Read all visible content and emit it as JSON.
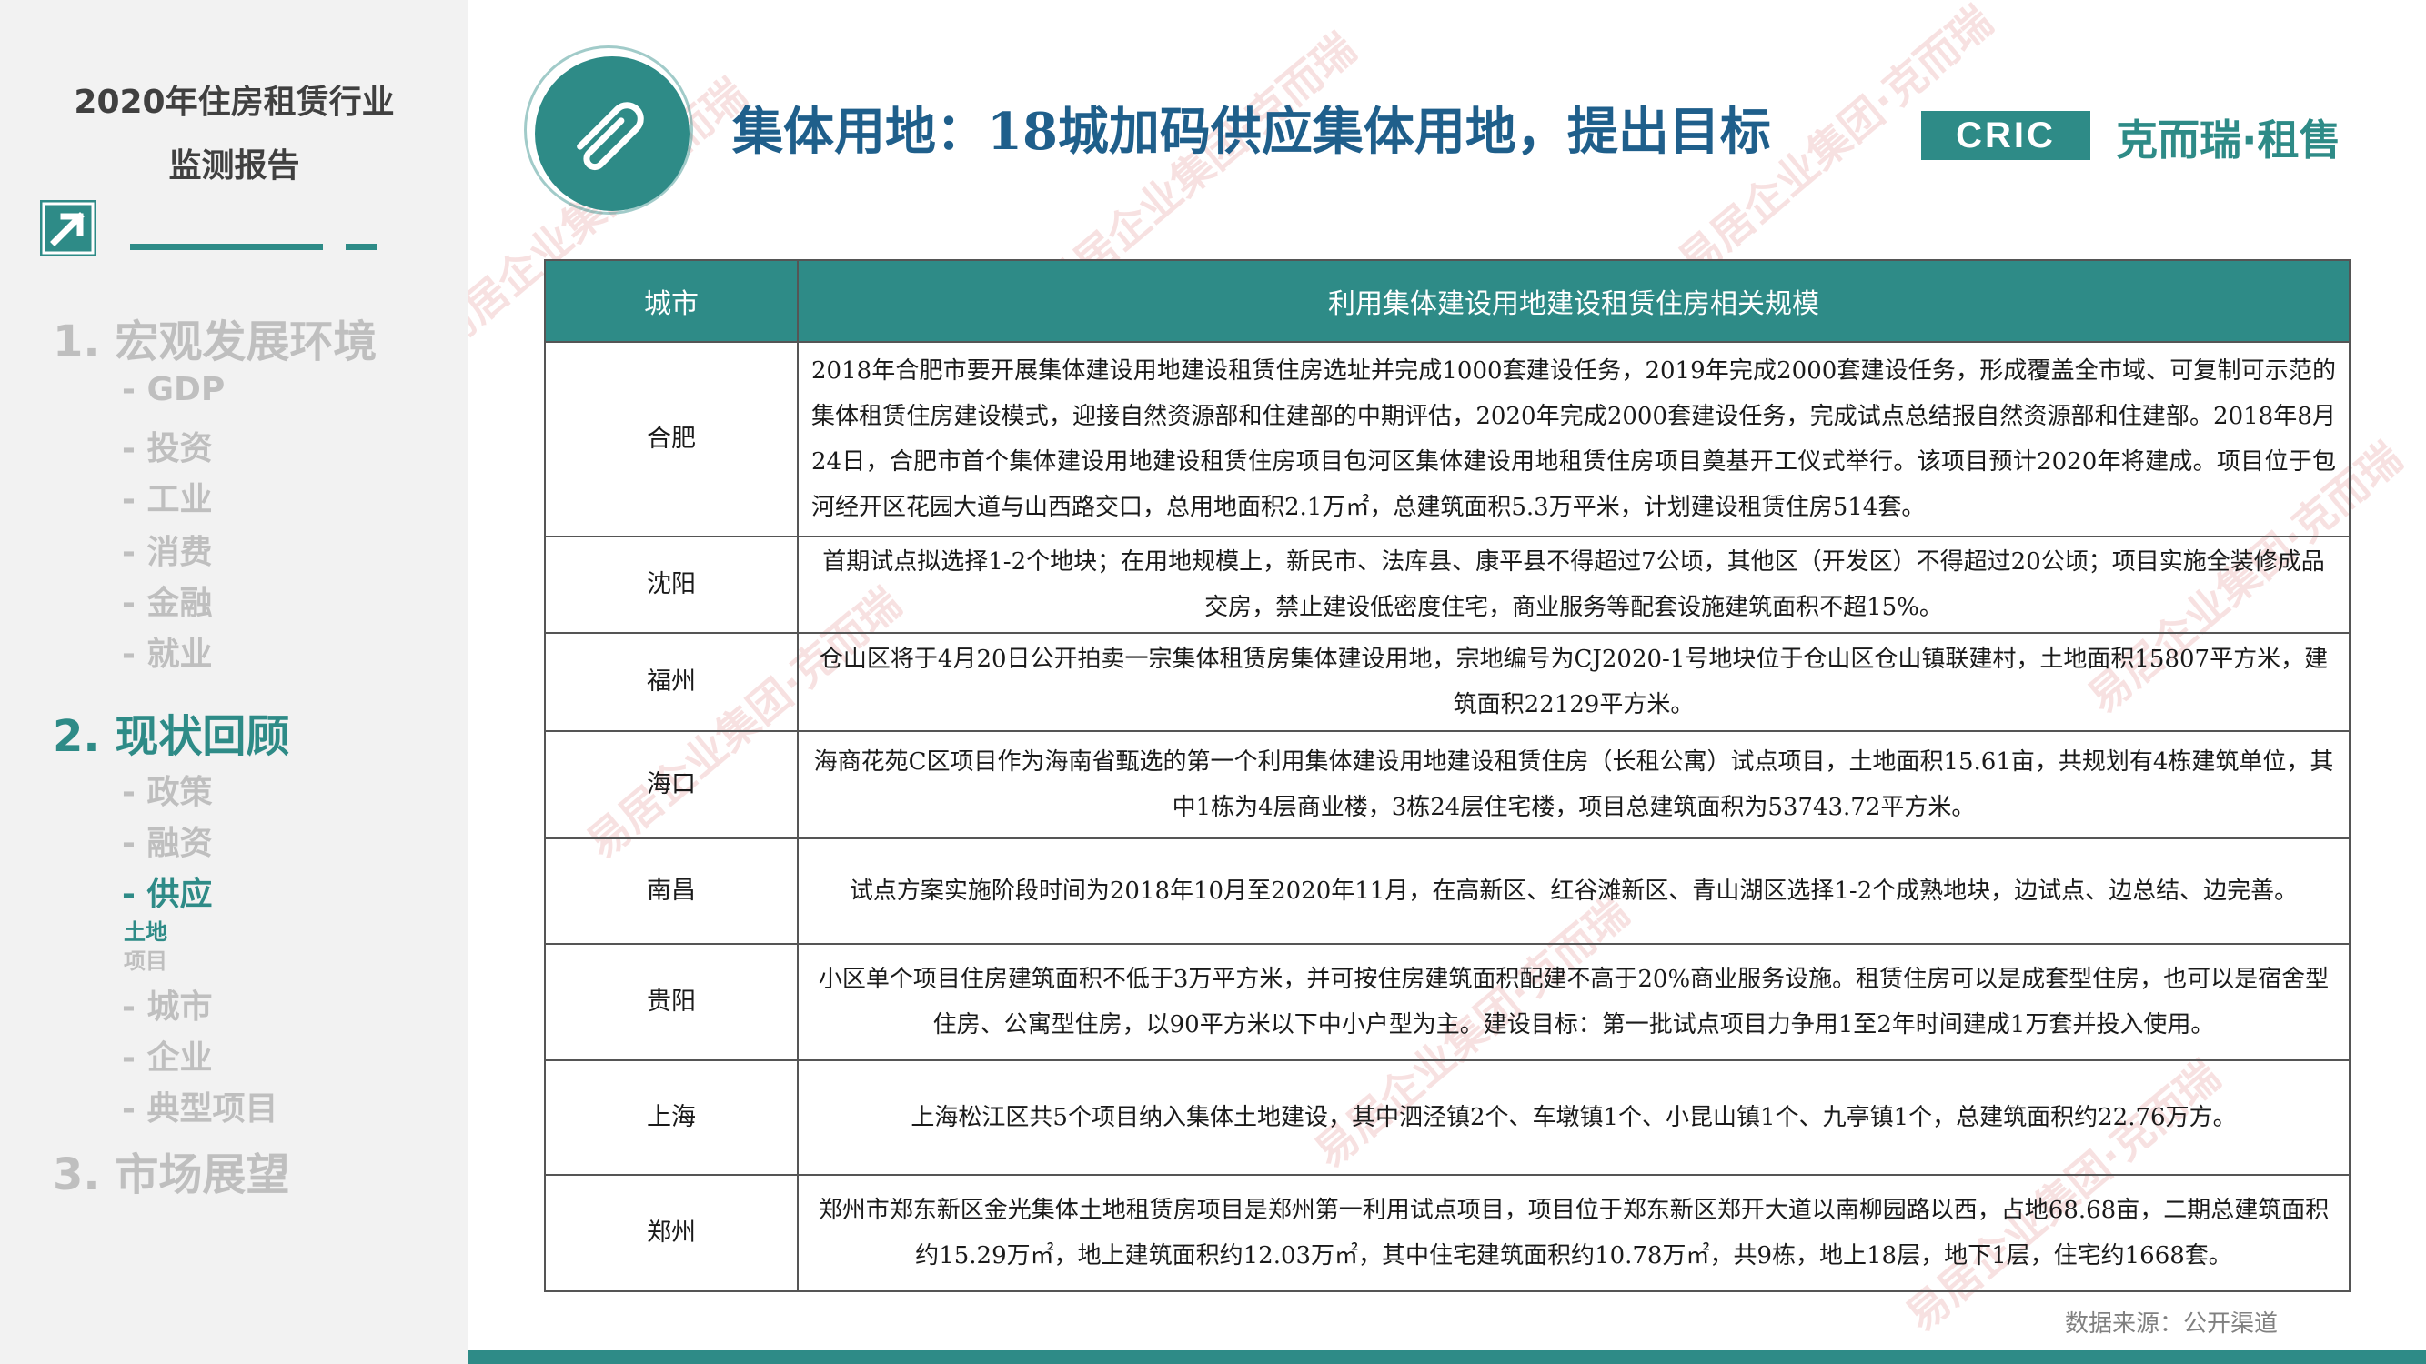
{
  "sidebar": {
    "title_line1": "2020年住房租赁行业",
    "title_line2": "监测报告",
    "sections": [
      {
        "label": "1. 宏观发展环境",
        "subs": [
          "- GDP",
          "- 投资",
          "- 工业",
          "- 消费",
          "- 金融",
          "- 就业"
        ]
      },
      {
        "label": "2. 现状回顾",
        "subs": [
          "- 政策",
          "- 融资",
          "- 供应",
          "- 城市",
          "- 企业",
          "- 典型项目"
        ],
        "supply_subs": [
          "土地",
          "项目"
        ]
      },
      {
        "label": "3. 市场展望"
      }
    ]
  },
  "header": {
    "title": "集体用地：18城加码供应集体用地，提出目标",
    "cric_logo": "CRIC",
    "brand_logo": "克而瑞·租售"
  },
  "table": {
    "headers": [
      "城市",
      "利用集体建设用地建设租赁住房相关规模"
    ],
    "rows": [
      {
        "city": "合肥",
        "text": "2018年合肥市要开展集体建设用地建设租赁住房选址并完成1000套建设任务，2019年完成2000套建设任务，形成覆盖全市域、可复制可示范的集体租赁住房建设模式，迎接自然资源部和住建部的中期评估，2020年完成2000套建设任务，完成试点总结报自然资源部和住建部。2018年8月24日，合肥市首个集体建设用地建设租赁住房项目包河区集体建设用地租赁住房项目奠基开工仪式举行。该项目预计2020年将建成。项目位于包河经开区花园大道与山西路交口，总用地面积2.1万㎡，总建筑面积5.3万平米，计划建设租赁住房514套。"
      },
      {
        "city": "沈阳",
        "text": "首期试点拟选择1-2个地块；在用地规模上，新民市、法库县、康平县不得超过7公顷，其他区（开发区）不得超过20公顷；项目实施全装修成品交房，禁止建设低密度住宅，商业服务等配套设施建筑面积不超15%。"
      },
      {
        "city": "福州",
        "text": "仓山区将于4月20日公开拍卖一宗集体租赁房集体建设用地，宗地编号为CJ2020-1号地块位于仓山区仓山镇联建村，土地面积15807平方米，建筑面积22129平方米。"
      },
      {
        "city": "海口",
        "text": "海商花苑C区项目作为海南省甄选的第一个利用集体建设用地建设租赁住房（长租公寓）试点项目，土地面积15.61亩，共规划有4栋建筑单位，其中1栋为4层商业楼，3栋24层住宅楼，项目总建筑面积为53743.72平方米。"
      },
      {
        "city": "南昌",
        "text": "试点方案实施阶段时间为2018年10月至2020年11月，在高新区、红谷滩新区、青山湖区选择1-2个成熟地块，边试点、边总结、边完善。"
      },
      {
        "city": "贵阳",
        "text": "小区单个项目住房建筑面积不低于3万平方米，并可按住房建筑面积配建不高于20%商业服务设施。租赁住房可以是成套型住房，也可以是宿舍型住房、公寓型住房，以90平方米以下中小户型为主。建设目标：第一批试点项目力争用1至2年时间建成1万套并投入使用。"
      },
      {
        "city": "上海",
        "text": "上海松江区共5个项目纳入集体土地建设，其中泗泾镇2个、车墩镇1个、小昆山镇1个、九亭镇1个，总建筑面积约22.76万方。"
      },
      {
        "city": "郑州",
        "text": "郑州市郑东新区金光集体土地租赁房项目是郑州第一利用试点项目，项目位于郑东新区郑开大道以南柳园路以西，占地68.68亩，二期总建筑面积约15.29万㎡，地上建筑面积约12.03万㎡，其中住宅建筑面积约10.78万㎡，共9栋，地上18层，地下1层，住宅约1668套。"
      }
    ]
  },
  "source": "数据来源：公开渠道",
  "watermark": "易居企业集团·克而瑞",
  "colors": {
    "accent": "#2e8b87",
    "title": "#1f5f8b",
    "sidebar_bg": "#f2f2f2"
  }
}
